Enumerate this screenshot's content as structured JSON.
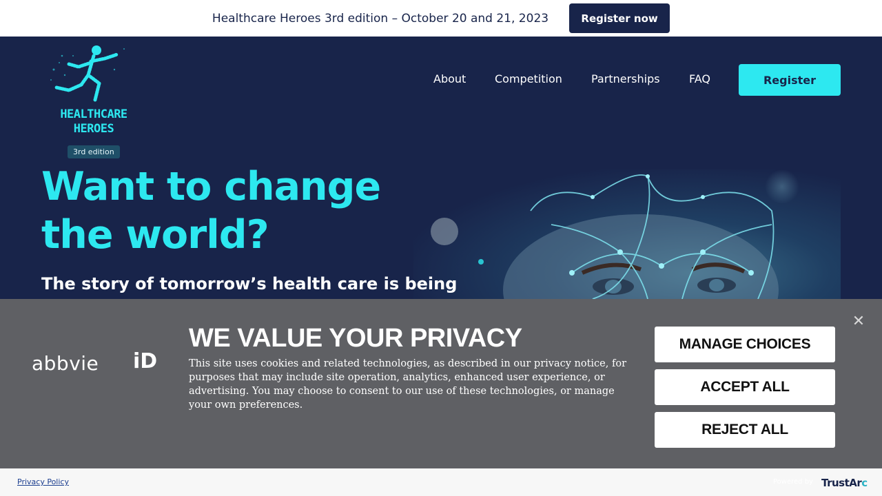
{
  "announcement": {
    "text": "Healthcare Heroes 3rd edition – October 20 and 21, 2023",
    "button_label": "Register now"
  },
  "logo": {
    "line1": "HEALTHCARE",
    "line2": "HEROES",
    "badge": "3rd edition"
  },
  "nav": {
    "items": [
      "About",
      "Competition",
      "Partnerships",
      "FAQ"
    ],
    "register_label": "Register"
  },
  "hero": {
    "title_line1": "Want to change",
    "title_line2": "the world?",
    "subtitle": "The story of tomorrow’s health care is being"
  },
  "privacy_banner": {
    "brand_text": "abbvie",
    "brand_id": "iD",
    "title": "WE VALUE YOUR PRIVACY",
    "description": "This site uses cookies and related technologies, as described in our privacy notice, for purposes that may include site operation, analytics, enhanced user experience, or advertising. You may choose to consent to our use of these technologies, or manage your own preferences.",
    "buttons": {
      "manage": "MANAGE CHOICES",
      "accept": "ACCEPT ALL",
      "reject": "REJECT ALL"
    }
  },
  "footer": {
    "privacy_policy": "Privacy Policy",
    "powered_by": "Powered by",
    "trustarc_main": "TrustAr",
    "trustarc_accent": "c"
  },
  "colors": {
    "navy": "#18244a",
    "cyan": "#2de8f0",
    "banner_gray": "#5f6064"
  }
}
